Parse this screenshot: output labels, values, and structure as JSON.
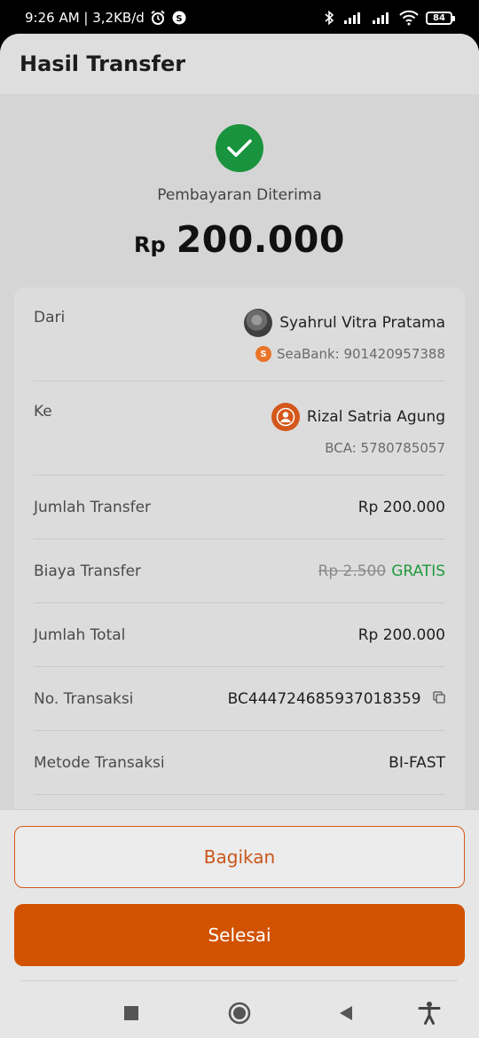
{
  "status_bar": {
    "time_speed": "9:26 AM | 3,2KB/d",
    "battery": "84"
  },
  "header": {
    "title": "Hasil Transfer"
  },
  "result": {
    "status_text": "Pembayaran Diterima",
    "currency": "Rp",
    "amount": "200.000",
    "status_color": "#19933d"
  },
  "details": {
    "from": {
      "label": "Dari",
      "name": "Syahrul Vitra Pratama",
      "account": "SeaBank: 901420957388"
    },
    "to": {
      "label": "Ke",
      "name": "Rizal Satria Agung",
      "account": "BCA: 5780785057"
    },
    "transfer_amount": {
      "label": "Jumlah Transfer",
      "value": "Rp 200.000"
    },
    "fee": {
      "label": "Biaya Transfer",
      "original": "Rp 2.500",
      "value": "GRATIS"
    },
    "total": {
      "label": "Jumlah Total",
      "value": "Rp 200.000"
    },
    "transaction_no": {
      "label": "No. Transaksi",
      "value": "BC444724685937018359"
    },
    "method": {
      "label": "Metode Transaksi",
      "value": "BI-FAST"
    }
  },
  "actions": {
    "share_label": "Bagikan",
    "done_label": "Selesai",
    "accent_color": "#d15200"
  },
  "icons": {
    "alarm": "alarm-icon",
    "bluetooth": "bluetooth-icon",
    "signal": "signal-icon",
    "wifi": "wifi-icon",
    "check": "check-icon",
    "copy": "copy-icon",
    "nav_recent": "square-icon",
    "nav_home": "circle-icon",
    "nav_back": "triangle-back-icon",
    "accessibility": "accessibility-icon"
  }
}
